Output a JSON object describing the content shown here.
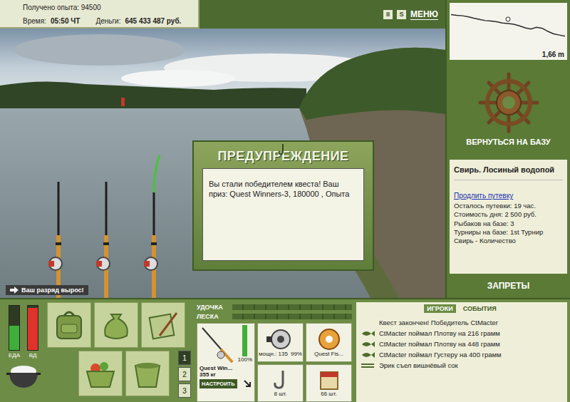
{
  "header": {
    "experience": "Получено опыта: 94500",
    "time_label": "Время:",
    "time": "05:50 ЧТ",
    "money_label": "Деньги:",
    "money": "645 433 487 руб."
  },
  "top_controls": {
    "pause": "II",
    "sound": "S",
    "menu": "МЕНЮ"
  },
  "depth_chart": {
    "reading": "1,66 m",
    "depths": [
      0.25,
      0.28,
      0.3,
      0.34,
      0.4,
      0.45,
      0.5,
      0.52,
      0.55,
      0.6,
      0.62,
      0.65,
      0.72,
      0.8,
      0.85,
      0.78,
      0.82,
      0.95,
      1.05,
      1.1,
      1.15
    ],
    "marker_index": 10
  },
  "base_button": "ВЕРНУТЬСЯ НА БАЗУ",
  "location": {
    "title": "Свирь. Лосиный водопой",
    "extend_link": "Продлить путевку",
    "details": [
      "Осталось путевки: 19 час.",
      "Стоимость дня: 2 500 руб.",
      "Рыбаков на базе: 3",
      "Турниры на базе: 1st Турнир Свирь - Количество"
    ]
  },
  "bans": "ЗАПРЕТЫ",
  "dialog": {
    "title": "ПРЕДУПРЕЖДЕНИЕ",
    "message": "Вы стали победителем квеста! Ваш приз: Quest Winners-3, 180000 , Опыта"
  },
  "rank_badge": "Ваш разряд вырос!",
  "rods": [
    {
      "selected": false
    },
    {
      "selected": false
    },
    {
      "selected": true
    }
  ],
  "needs": [
    {
      "label": "ЕДА",
      "level": 0.55,
      "color": "#3fae3a"
    },
    {
      "label": "ВД",
      "level": 0.95,
      "color": "#e0332b"
    }
  ],
  "inventory_pages": [
    {
      "label": "1",
      "selected": true
    },
    {
      "label": "2",
      "selected": false
    },
    {
      "label": "3",
      "selected": false
    }
  ],
  "tension": [
    {
      "label": "УДОЧКА",
      "level": 0
    },
    {
      "label": "ЛЕСКА",
      "level": 0
    }
  ],
  "tackle": {
    "rod": {
      "name": "Quest Win...",
      "weight": "355 кг",
      "condition": "100%",
      "level": 1.0,
      "button": "НАСТРОИТЬ"
    },
    "reel": {
      "power": "мощн.: 135",
      "condition": "99%"
    },
    "line": {
      "name": "Quest Fis..."
    },
    "hook": {
      "count": "8 шт."
    },
    "bait": {
      "count": "66 шт."
    }
  },
  "log": {
    "tabs": [
      {
        "label": "ИГРОКИ",
        "selected": true
      },
      {
        "label": "СОБЫТИЯ",
        "selected": false
      }
    ],
    "entries": [
      {
        "kind": "text",
        "text": "Квест закончен! Победитель CtMacter"
      },
      {
        "kind": "fish",
        "text": "CtMacter поймал Плотву на 216 грамм"
      },
      {
        "kind": "fish",
        "text": "CtMacter поймал Плотву на 448 грамм"
      },
      {
        "kind": "fish",
        "text": "CtMacter поймал Густеру на 400 грамм"
      },
      {
        "kind": "food",
        "text": "Эрик съел вишнёвый сок"
      }
    ]
  }
}
